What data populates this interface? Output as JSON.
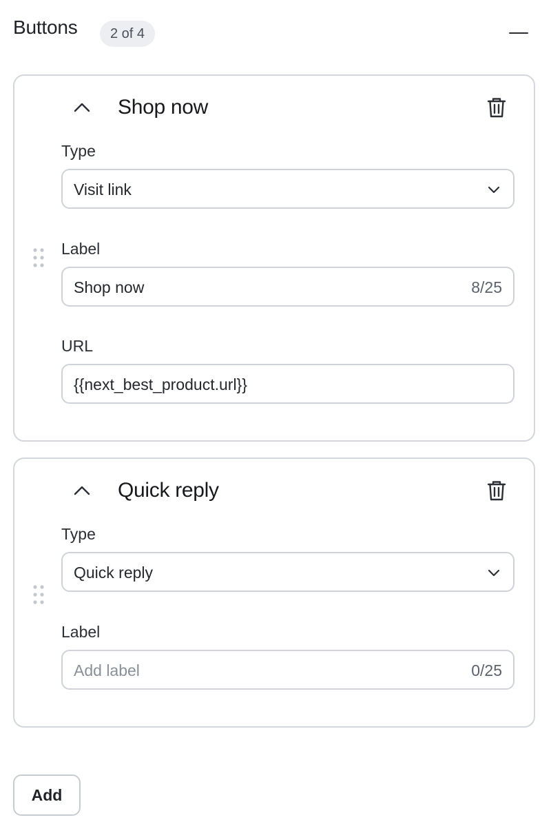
{
  "section": {
    "title": "Buttons",
    "count_badge": "2 of 4"
  },
  "buttons": [
    {
      "title": "Shop now",
      "type_label": "Type",
      "type_value": "Visit link",
      "label_label": "Label",
      "label_value": "Shop now",
      "label_counter": "8/25",
      "url_label": "URL",
      "url_value": "{{next_best_product.url}}"
    },
    {
      "title": "Quick reply",
      "type_label": "Type",
      "type_value": "Quick reply",
      "label_label": "Label",
      "label_placeholder": "Add label",
      "label_counter": "0/25"
    }
  ],
  "footer": {
    "add_label": "Add"
  },
  "icons": {
    "collapse": "minus-icon",
    "expand_toggle": "chevron-up-icon",
    "delete": "trash-icon",
    "dropdown": "chevron-down-icon",
    "drag": "drag-handle-icon"
  },
  "colors": {
    "border": "#d3d6dc",
    "badge_bg": "#eceef1",
    "text": "#1f2328",
    "placeholder": "#8a9098"
  }
}
